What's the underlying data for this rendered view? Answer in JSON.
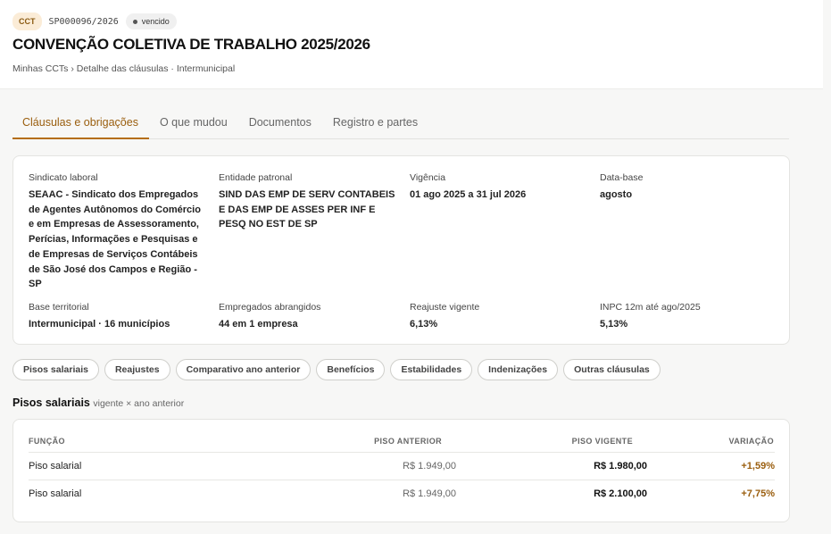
{
  "header": {
    "badge": "CCT",
    "code": "SP000096/2026",
    "status": "vencido",
    "title": "CONVENÇÃO COLETIVA DE TRABALHO 2025/2026",
    "breadcrumb": "Minhas CCTs › Detalhe das cláusulas · Intermunicipal"
  },
  "tabs": [
    {
      "label": "Cláusulas e obrigações",
      "active": true
    },
    {
      "label": "O que mudou",
      "active": false
    },
    {
      "label": "Documentos",
      "active": false
    },
    {
      "label": "Registro e partes",
      "active": false
    }
  ],
  "info": {
    "sindicato_label": "Sindicato laboral",
    "sindicato_value": "SEAAC - Sindicato dos Empregados de Agentes Autônomos do Comércio e em Empresas de Assessoramento, Perícias, Informações e Pesquisas e de Empresas de Serviços Contábeis de São José dos Campos e Região - SP",
    "entidade_label": "Entidade patronal",
    "entidade_value": "SIND DAS EMP DE SERV CONTABEIS E DAS EMP DE ASSES PER INF E PESQ NO EST DE SP",
    "vigencia_label": "Vigência",
    "vigencia_value": "01 ago 2025 a 31 jul 2026",
    "database_label": "Data-base",
    "database_value": "agosto",
    "base_label": "Base territorial",
    "base_value": "Intermunicipal · 16 municípios",
    "empregados_label": "Empregados abrangidos",
    "empregados_value": "44 em 1 empresa",
    "reajuste_label": "Reajuste vigente",
    "reajuste_value": "6,13%",
    "inpc_label": "INPC 12m até ago/2025",
    "inpc_value": "5,13%"
  },
  "chips": [
    "Pisos salariais",
    "Reajustes",
    "Comparativo ano anterior",
    "Benefícios",
    "Estabilidades",
    "Indenizações",
    "Outras cláusulas"
  ],
  "section": {
    "title": "Pisos salariais",
    "subtitle": "vigente × ano anterior"
  },
  "table": {
    "headers": [
      "FUNÇÃO",
      "PISO ANTERIOR",
      "PISO VIGENTE",
      "VARIAÇÃO"
    ],
    "rows": [
      {
        "funcao": "Piso salarial",
        "anterior": "R$ 1.949,00",
        "vigente": "R$ 1.980,00",
        "variacao": "+1,59%"
      },
      {
        "funcao": "Piso salarial",
        "anterior": "R$ 1.949,00",
        "vigente": "R$ 2.100,00",
        "variacao": "+7,75%"
      }
    ]
  },
  "colors": {
    "accent": "#9a5e0e",
    "badge_bg": "#fbecd7"
  }
}
